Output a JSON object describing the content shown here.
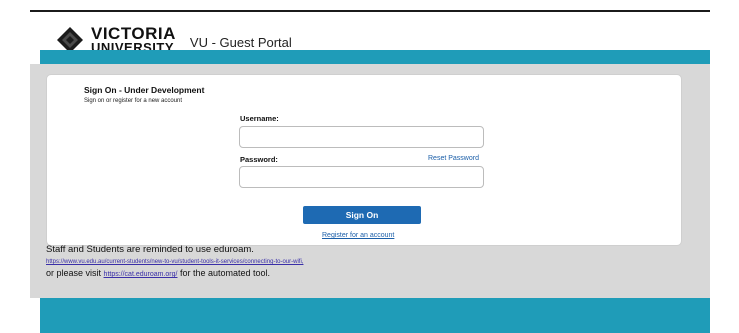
{
  "header": {
    "logo_line1": "VICTORIA",
    "logo_line2": "UNIVERSITY",
    "portal_title": "VU - Guest Portal"
  },
  "signon": {
    "title": "Sign On - Under Development",
    "subtitle": "Sign on or register for a new account",
    "username_label": "Username:",
    "username_value": "",
    "password_label": "Password:",
    "password_value": "",
    "reset_password": "Reset Password",
    "signon_button": "Sign On",
    "register_link": "Register for an account"
  },
  "notice": {
    "line1": "Staff and Students are reminded to use eduroam.",
    "link1": "https://www.vu.edu.au/current-students/new-to-vu/student-tools-it-services/connecting-to-our-wifi,",
    "line3_prefix": "or please visit",
    "link2": "https://cat.eduroam.org/",
    "line3_suffix": "for the automated tool."
  },
  "colors": {
    "teal_panel": "#1f9cb8",
    "gray_panel": "#d8d8d8",
    "button_blue": "#1e6ab3",
    "link_blue": "#1a5ea8"
  }
}
